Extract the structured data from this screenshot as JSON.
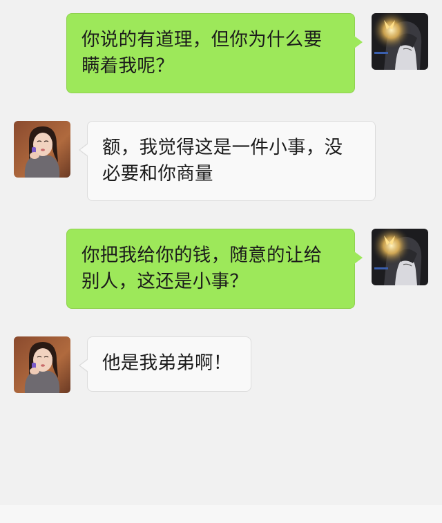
{
  "chat": {
    "messages": [
      {
        "side": "sent",
        "avatar": "anime-girl-butterfly-avatar",
        "text": "你说的有道理，但你为什么要瞒着我呢？"
      },
      {
        "side": "received",
        "avatar": "woman-photo-avatar",
        "text": "额，我觉得这是一件小事，没必要和你商量"
      },
      {
        "side": "sent",
        "avatar": "anime-girl-butterfly-avatar",
        "text": "你把我给你的钱，随意的让给别人，这还是小事？"
      },
      {
        "side": "received",
        "avatar": "woman-photo-avatar",
        "text": "他是我弟弟啊！"
      }
    ]
  },
  "colors": {
    "background": "#f1f1f1",
    "sent_bubble": "#9de85a",
    "received_bubble": "#f9f9f9",
    "text": "#1b1b1b"
  }
}
